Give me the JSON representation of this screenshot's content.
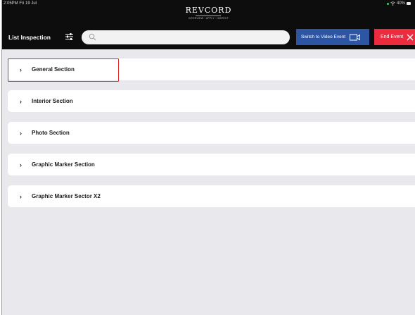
{
  "status_bar": {
    "time": "2:05PM  Fri 19 Jul",
    "battery": "40%"
  },
  "logo": {
    "name": "REVCORD",
    "tagline": "INTERVIEW · APPLY · INSPECT"
  },
  "header": {
    "title": "List Inspection",
    "video_button": "Switch to Video Event",
    "end_button": "End Event"
  },
  "search": {
    "placeholder": "",
    "value": ""
  },
  "sections": [
    {
      "label": "General Section"
    },
    {
      "label": "Interior Section"
    },
    {
      "label": "Photo Section"
    },
    {
      "label": "Graphic Marker Section"
    },
    {
      "label": "Graphic Marker Sector X2"
    }
  ],
  "colors": {
    "header_bg": "#0d0d0d",
    "video_button": "#2e55a3",
    "end_button": "#ec2b3e",
    "highlight_border": "#e12b2b"
  }
}
